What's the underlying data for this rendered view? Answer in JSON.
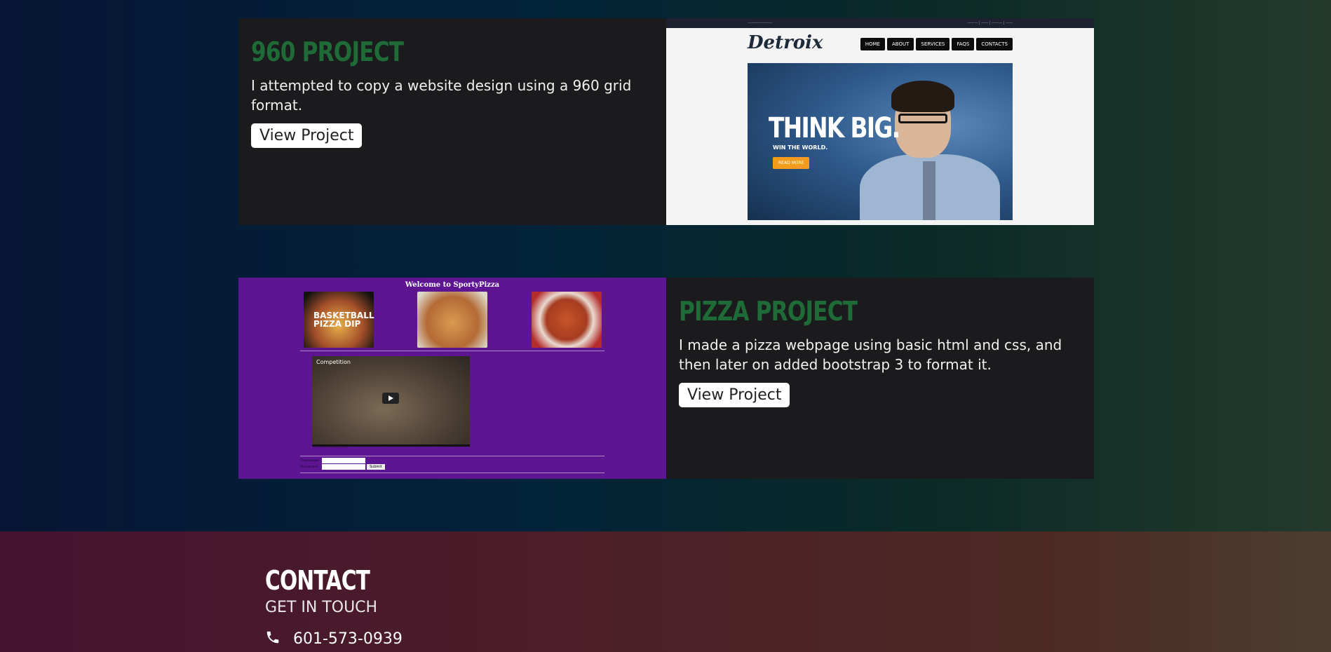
{
  "projects": [
    {
      "title": "960 PROJECT",
      "description": "I attempted to copy a website design using a 960 grid format.",
      "button_label": "View Project",
      "preview": {
        "logo": "Detroix",
        "nav": [
          "HOME",
          "ABOUT",
          "SERVICES",
          "FAQS",
          "CONTACTS"
        ],
        "hero_title": "THINK BIG.",
        "hero_sub": "WIN THE WORLD.",
        "hero_button": "READ MORE"
      }
    },
    {
      "title": "PIZZA PROJECT",
      "description": "I made a pizza webpage using basic html and css, and then later on added bootstrap 3 to format it.",
      "button_label": "View Project",
      "preview": {
        "heading": "Welcome to SportyPizza",
        "image_label_1": "BASKETBALL",
        "image_label_2": "PIZZA DIP",
        "video_title": "Competition",
        "form_labels": [
          "Username:",
          "Password:"
        ],
        "submit_label": "Submit"
      }
    }
  ],
  "contact": {
    "title": "CONTACT",
    "subtitle": "GET IN TOUCH",
    "phone": "601-573-0939",
    "phone_icon": "phone-icon"
  },
  "colors": {
    "project_title": "#1e6b37",
    "card_bg": "#1b1b1d",
    "pizza_bg": "#5e1592"
  }
}
